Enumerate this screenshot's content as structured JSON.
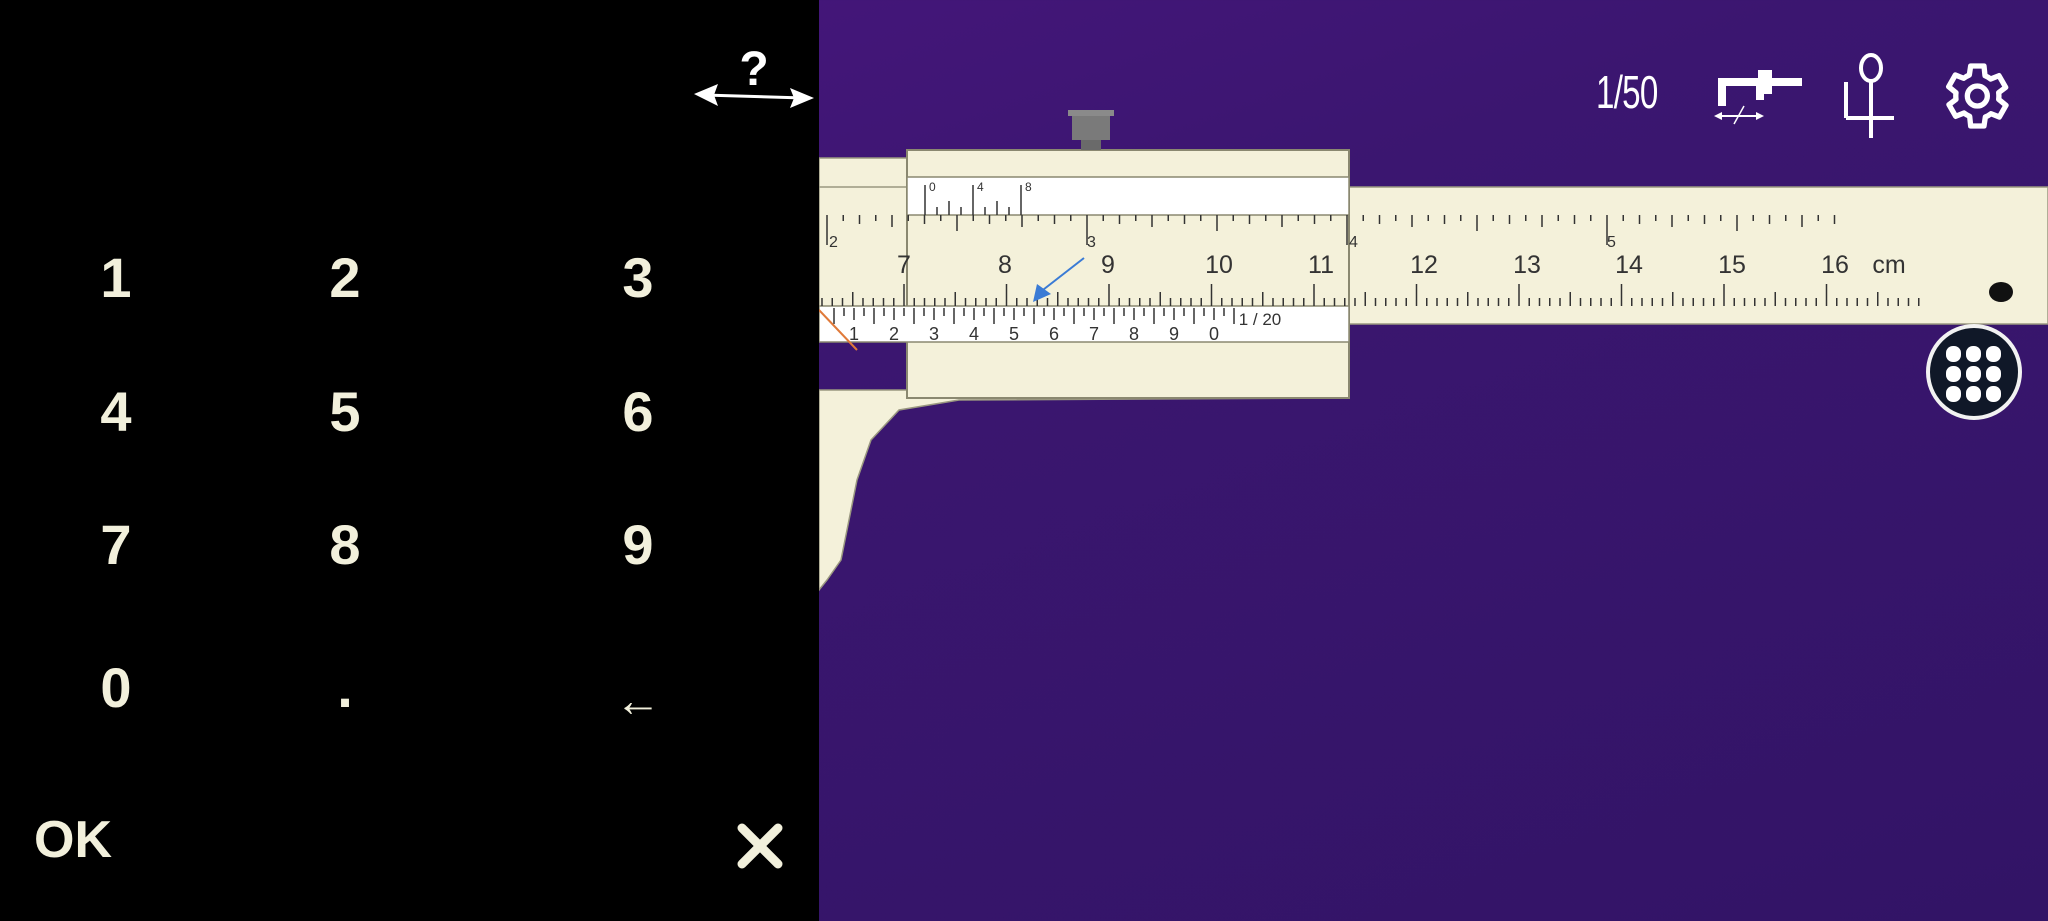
{
  "keypad": {
    "help_label": "?",
    "keys": [
      "1",
      "2",
      "3",
      "4",
      "5",
      "6",
      "7",
      "8",
      "9",
      "0",
      ".",
      "←"
    ],
    "ok_label": "OK",
    "close_icon": "close-icon",
    "text_color": "#f2f0dc"
  },
  "toolbar": {
    "resolution_label": "1/50",
    "caliper_icon": "caliper-icon",
    "depth_icon": "depth-gauge-icon",
    "settings_icon": "gear-icon"
  },
  "caliper": {
    "main_scale_numbers": [
      "7",
      "8",
      "9",
      "10",
      "11",
      "12",
      "13",
      "14",
      "15",
      "16"
    ],
    "main_scale_unit": "cm",
    "inch_scale_numbers": [
      "2",
      "3",
      "4",
      "5"
    ],
    "vernier_numbers": [
      "1",
      "2",
      "3",
      "4",
      "5",
      "6",
      "7",
      "8",
      "9",
      "0"
    ],
    "vernier_label": "1 / 20",
    "upper_vernier_numbers": [
      "0",
      "4",
      "8"
    ],
    "body_color": "#f4f1da",
    "background_color": "#3b1670",
    "pointer_color": "#3a7bd5"
  },
  "keypad_toggle_icon": "keypad-grid-icon"
}
